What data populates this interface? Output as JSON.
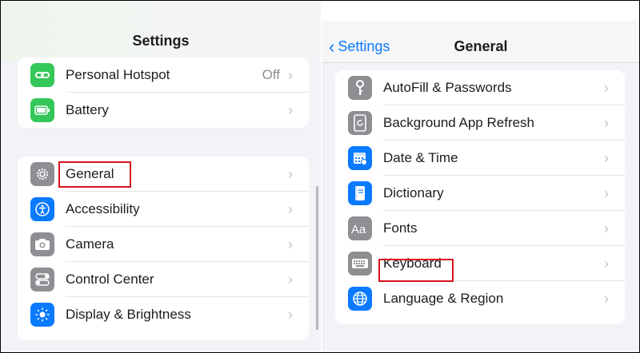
{
  "left": {
    "title": "Settings",
    "group1": [
      {
        "label": "Personal Hotspot",
        "value": "Off",
        "icon": "link-icon",
        "color": "#34c759"
      },
      {
        "label": "Battery",
        "value": "",
        "icon": "battery-icon",
        "color": "#34c759"
      }
    ],
    "group2": [
      {
        "label": "General",
        "icon": "gear-icon",
        "color": "#8e8e93"
      },
      {
        "label": "Accessibility",
        "icon": "accessibility-icon",
        "color": "#0a7aff"
      },
      {
        "label": "Camera",
        "icon": "camera-icon",
        "color": "#8e8e93"
      },
      {
        "label": "Control Center",
        "icon": "toggles-icon",
        "color": "#8e8e93"
      },
      {
        "label": "Display & Brightness",
        "icon": "sun-icon",
        "color": "#0a7aff"
      }
    ]
  },
  "right": {
    "back_label": "Settings",
    "title": "General",
    "items": [
      {
        "label": "AutoFill & Passwords",
        "icon": "key-icon",
        "color": "#8e8e93"
      },
      {
        "label": "Background App Refresh",
        "icon": "refresh-icon",
        "color": "#8e8e93"
      },
      {
        "label": "Date & Time",
        "icon": "calendar-icon",
        "color": "#0a7aff"
      },
      {
        "label": "Dictionary",
        "icon": "book-icon",
        "color": "#0a7aff"
      },
      {
        "label": "Fonts",
        "icon": "fonts-icon",
        "color": "#8e8e93"
      },
      {
        "label": "Keyboard",
        "icon": "keyboard-icon",
        "color": "#8e8e93"
      },
      {
        "label": "Language & Region",
        "icon": "globe-icon",
        "color": "#0a7aff"
      }
    ]
  },
  "colors": {
    "highlight": "#d8141c",
    "accent": "#0a7aff",
    "green": "#34c759"
  }
}
